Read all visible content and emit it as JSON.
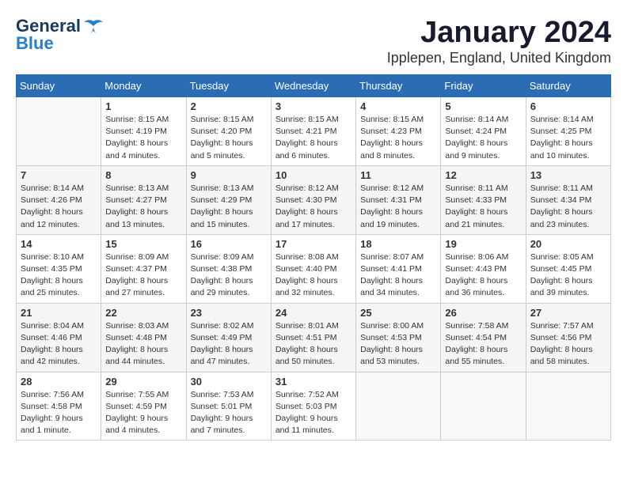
{
  "header": {
    "logo_general": "General",
    "logo_blue": "Blue",
    "month": "January 2024",
    "location": "Ipplepen, England, United Kingdom"
  },
  "days_of_week": [
    "Sunday",
    "Monday",
    "Tuesday",
    "Wednesday",
    "Thursday",
    "Friday",
    "Saturday"
  ],
  "weeks": [
    [
      {
        "day": "",
        "info": ""
      },
      {
        "day": "1",
        "info": "Sunrise: 8:15 AM\nSunset: 4:19 PM\nDaylight: 8 hours\nand 4 minutes."
      },
      {
        "day": "2",
        "info": "Sunrise: 8:15 AM\nSunset: 4:20 PM\nDaylight: 8 hours\nand 5 minutes."
      },
      {
        "day": "3",
        "info": "Sunrise: 8:15 AM\nSunset: 4:21 PM\nDaylight: 8 hours\nand 6 minutes."
      },
      {
        "day": "4",
        "info": "Sunrise: 8:15 AM\nSunset: 4:23 PM\nDaylight: 8 hours\nand 8 minutes."
      },
      {
        "day": "5",
        "info": "Sunrise: 8:14 AM\nSunset: 4:24 PM\nDaylight: 8 hours\nand 9 minutes."
      },
      {
        "day": "6",
        "info": "Sunrise: 8:14 AM\nSunset: 4:25 PM\nDaylight: 8 hours\nand 10 minutes."
      }
    ],
    [
      {
        "day": "7",
        "info": "Sunrise: 8:14 AM\nSunset: 4:26 PM\nDaylight: 8 hours\nand 12 minutes."
      },
      {
        "day": "8",
        "info": "Sunrise: 8:13 AM\nSunset: 4:27 PM\nDaylight: 8 hours\nand 13 minutes."
      },
      {
        "day": "9",
        "info": "Sunrise: 8:13 AM\nSunset: 4:29 PM\nDaylight: 8 hours\nand 15 minutes."
      },
      {
        "day": "10",
        "info": "Sunrise: 8:12 AM\nSunset: 4:30 PM\nDaylight: 8 hours\nand 17 minutes."
      },
      {
        "day": "11",
        "info": "Sunrise: 8:12 AM\nSunset: 4:31 PM\nDaylight: 8 hours\nand 19 minutes."
      },
      {
        "day": "12",
        "info": "Sunrise: 8:11 AM\nSunset: 4:33 PM\nDaylight: 8 hours\nand 21 minutes."
      },
      {
        "day": "13",
        "info": "Sunrise: 8:11 AM\nSunset: 4:34 PM\nDaylight: 8 hours\nand 23 minutes."
      }
    ],
    [
      {
        "day": "14",
        "info": "Sunrise: 8:10 AM\nSunset: 4:35 PM\nDaylight: 8 hours\nand 25 minutes."
      },
      {
        "day": "15",
        "info": "Sunrise: 8:09 AM\nSunset: 4:37 PM\nDaylight: 8 hours\nand 27 minutes."
      },
      {
        "day": "16",
        "info": "Sunrise: 8:09 AM\nSunset: 4:38 PM\nDaylight: 8 hours\nand 29 minutes."
      },
      {
        "day": "17",
        "info": "Sunrise: 8:08 AM\nSunset: 4:40 PM\nDaylight: 8 hours\nand 32 minutes."
      },
      {
        "day": "18",
        "info": "Sunrise: 8:07 AM\nSunset: 4:41 PM\nDaylight: 8 hours\nand 34 minutes."
      },
      {
        "day": "19",
        "info": "Sunrise: 8:06 AM\nSunset: 4:43 PM\nDaylight: 8 hours\nand 36 minutes."
      },
      {
        "day": "20",
        "info": "Sunrise: 8:05 AM\nSunset: 4:45 PM\nDaylight: 8 hours\nand 39 minutes."
      }
    ],
    [
      {
        "day": "21",
        "info": "Sunrise: 8:04 AM\nSunset: 4:46 PM\nDaylight: 8 hours\nand 42 minutes."
      },
      {
        "day": "22",
        "info": "Sunrise: 8:03 AM\nSunset: 4:48 PM\nDaylight: 8 hours\nand 44 minutes."
      },
      {
        "day": "23",
        "info": "Sunrise: 8:02 AM\nSunset: 4:49 PM\nDaylight: 8 hours\nand 47 minutes."
      },
      {
        "day": "24",
        "info": "Sunrise: 8:01 AM\nSunset: 4:51 PM\nDaylight: 8 hours\nand 50 minutes."
      },
      {
        "day": "25",
        "info": "Sunrise: 8:00 AM\nSunset: 4:53 PM\nDaylight: 8 hours\nand 53 minutes."
      },
      {
        "day": "26",
        "info": "Sunrise: 7:58 AM\nSunset: 4:54 PM\nDaylight: 8 hours\nand 55 minutes."
      },
      {
        "day": "27",
        "info": "Sunrise: 7:57 AM\nSunset: 4:56 PM\nDaylight: 8 hours\nand 58 minutes."
      }
    ],
    [
      {
        "day": "28",
        "info": "Sunrise: 7:56 AM\nSunset: 4:58 PM\nDaylight: 9 hours\nand 1 minute."
      },
      {
        "day": "29",
        "info": "Sunrise: 7:55 AM\nSunset: 4:59 PM\nDaylight: 9 hours\nand 4 minutes."
      },
      {
        "day": "30",
        "info": "Sunrise: 7:53 AM\nSunset: 5:01 PM\nDaylight: 9 hours\nand 7 minutes."
      },
      {
        "day": "31",
        "info": "Sunrise: 7:52 AM\nSunset: 5:03 PM\nDaylight: 9 hours\nand 11 minutes."
      },
      {
        "day": "",
        "info": ""
      },
      {
        "day": "",
        "info": ""
      },
      {
        "day": "",
        "info": ""
      }
    ]
  ]
}
